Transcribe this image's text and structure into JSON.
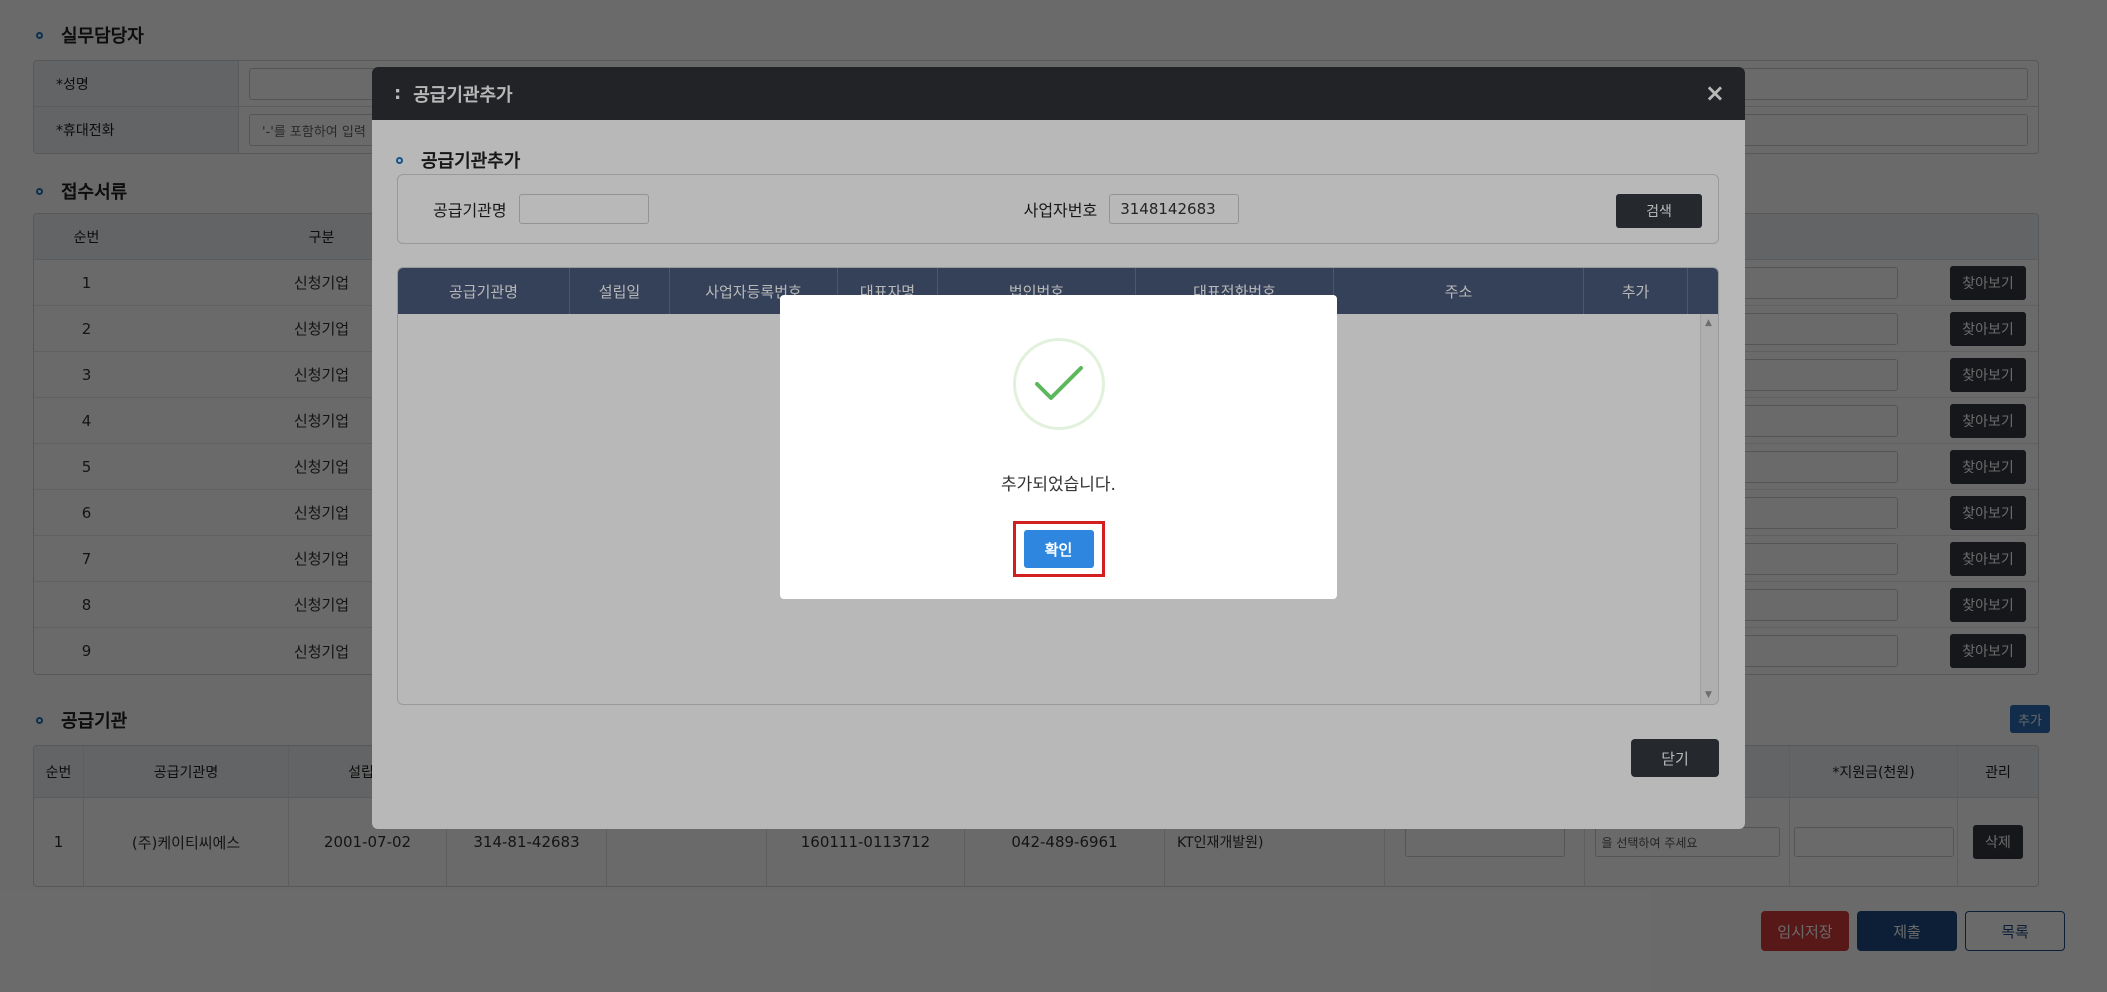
{
  "contact": {
    "title": "실무담당자",
    "fields": [
      {
        "label": "*성명",
        "value": ""
      },
      {
        "label": "*휴대전화",
        "placeholder": "'-'를 포함하여 입력"
      }
    ]
  },
  "documents": {
    "title": "접수서류",
    "headers": {
      "no": "순번",
      "kind": "구분"
    },
    "find_label": "찾아보기",
    "rows": [
      {
        "no": "1",
        "kind": "신청기업"
      },
      {
        "no": "2",
        "kind": "신청기업"
      },
      {
        "no": "3",
        "kind": "신청기업"
      },
      {
        "no": "4",
        "kind": "신청기업"
      },
      {
        "no": "5",
        "kind": "신청기업"
      },
      {
        "no": "6",
        "kind": "신청기업"
      },
      {
        "no": "7",
        "kind": "신청기업"
      },
      {
        "no": "8",
        "kind": "신청기업"
      },
      {
        "no": "9",
        "kind": "신청기업"
      }
    ]
  },
  "suppliers": {
    "title": "공급기관",
    "add_label": "추가",
    "headers": [
      "순번",
      "공급기관명",
      "설립일",
      "",
      "",
      "",
      "",
      "",
      "",
      "",
      "*지원금(천원)",
      "관리"
    ],
    "row": {
      "no": "1",
      "name": "(주)케이티씨에스",
      "founded": "2001-07-02",
      "bizno": "314-81-42683",
      "ceo": "",
      "corpno": "160111-0113712",
      "phone": "042-489-6961",
      "address1": "",
      "address2": "KT인재개발원)",
      "select_text": "을 선택하여 주세요",
      "delete_label": "삭제"
    }
  },
  "bottom": {
    "temp_save": "임시저장",
    "submit": "제출",
    "list": "목록"
  },
  "modal": {
    "title": "공급기관추가",
    "close_icon": "×",
    "section_title": "공급기관추가",
    "search": {
      "name_label": "공급기관명",
      "name_value": "",
      "bizno_label": "사업자번호",
      "bizno_value": "3148142683",
      "search_label": "검색"
    },
    "grid_headers": [
      "공급기관명",
      "설립일",
      "사업자등록번호",
      "대표자명",
      "법인번호",
      "대표전화번호",
      "주소",
      "추가"
    ],
    "close_label": "닫기"
  },
  "alert": {
    "message": "추가되었습니다.",
    "confirm_label": "확인",
    "check_color": "#5cb85c"
  }
}
